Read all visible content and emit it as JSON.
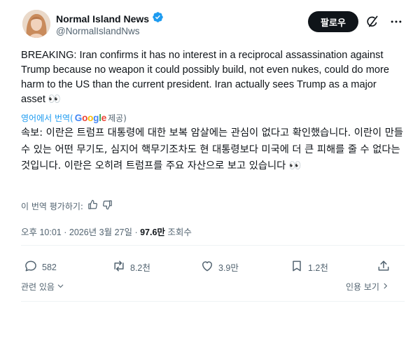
{
  "author": {
    "name": "Normal Island News",
    "handle": "@NormalIslandNws",
    "verified": true
  },
  "follow_button": {
    "label": "팔로우"
  },
  "tweet": {
    "text_en": "BREAKING: Iran confirms it has no interest in a reciprocal assassination against Trump because no weapon it could possibly build, not even nukes, could do more harm to the US than the current president. Iran actually sees Trump as a major asset 👀",
    "translation_source": {
      "prefix": "영어에서 번역(",
      "provider": "Google",
      "suffix": " 제공)"
    },
    "text_ko": "속보: 이란은 트럼프 대통령에 대한 보복 암살에는 관심이 없다고 확인했습니다. 이란이 만들 수 있는 어떤 무기도, 심지어 핵무기조차도 현 대통령보다 미국에 더 큰 피해를 줄 수 없다는 것입니다. 이란은 오히려 트럼프를 주요 자산으로 보고 있습니다 👀",
    "rate_translation": "이 번역 평가하기:",
    "time": "오후 10:01 · 2026년 3월 27일 · ",
    "views_count": "97.6만",
    "views_label": " 조회수"
  },
  "actions": {
    "replies": "582",
    "reposts": "8.2천",
    "likes": "3.9만",
    "bookmarks": "1.2천"
  },
  "footer": {
    "related": "관련 있음",
    "quotes": "인용 보기"
  },
  "icons": {
    "verified": "verified-badge-icon",
    "grok": "grok-icon",
    "more": "more-icon",
    "reply": "reply-icon",
    "repost": "repost-icon",
    "like": "like-icon",
    "bookmark": "bookmark-icon",
    "share": "share-icon",
    "thumbs_up": "thumbs-up-icon",
    "thumbs_down": "thumbs-down-icon"
  },
  "colors": {
    "accent": "#1d9bf0",
    "text": "#0f1419",
    "muted": "#536471",
    "button": "#0f1419"
  }
}
